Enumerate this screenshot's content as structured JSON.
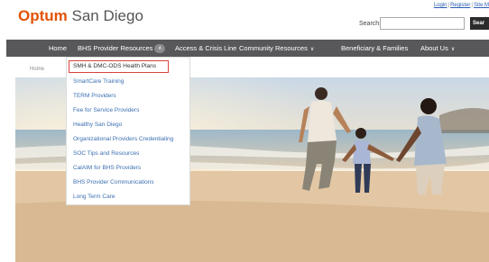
{
  "brand": {
    "name": "Optum",
    "location": "San Diego"
  },
  "top_links": {
    "login": "Login",
    "register": "Register",
    "site": "Site M"
  },
  "search": {
    "label": "Search:",
    "value": "",
    "button": "Sear"
  },
  "nav": {
    "items": [
      {
        "label": "Home"
      },
      {
        "label": "BHS Provider Resources"
      },
      {
        "label": "Access & Crisis Line"
      },
      {
        "label": "Community Resources"
      },
      {
        "label": "Beneficiary & Families"
      },
      {
        "label": "About Us"
      }
    ],
    "chevron": "∨",
    "expanded_icon": "∧"
  },
  "breadcrumb": {
    "home": "Home"
  },
  "dropdown": {
    "items": [
      {
        "label": "SMH & DMC-ODS Health Plans"
      },
      {
        "label": "SmartCare Training"
      },
      {
        "label": "TERM Providers"
      },
      {
        "label": "Fee for Service Providers"
      },
      {
        "label": "Healthy San Diego"
      },
      {
        "label": "Organizational Providers Credentialing"
      },
      {
        "label": "SOC Tips and Resources"
      },
      {
        "label": "CalAIM for BHS Providers"
      },
      {
        "label": "BHS Provider Communications"
      },
      {
        "label": "Long Term Care"
      }
    ]
  },
  "colors": {
    "brand_orange": "#e35205",
    "nav_bg": "#58585a",
    "link_blue": "#3b6fb0",
    "highlight_red": "#d9443a"
  }
}
